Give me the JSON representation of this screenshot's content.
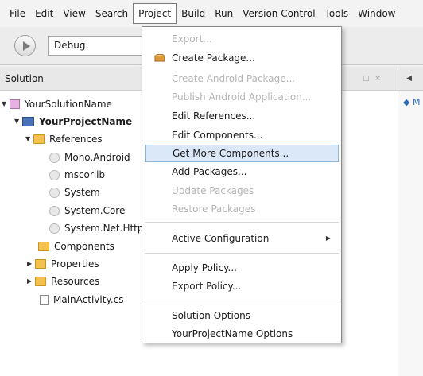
{
  "menubar": {
    "items": [
      "File",
      "Edit",
      "View",
      "Search",
      "Project",
      "Build",
      "Run",
      "Version Control",
      "Tools",
      "Window"
    ],
    "active": "Project"
  },
  "toolbar": {
    "configuration": "Debug"
  },
  "solution_pane": {
    "title": "Solution",
    "controls": "□ ×",
    "tree": [
      {
        "label": "YourSolutionName",
        "icon": "solution-icon",
        "expanded": true
      },
      {
        "label": "YourProjectName",
        "icon": "project-icon",
        "expanded": true,
        "bold": true
      },
      {
        "label": "References",
        "icon": "folder-icon",
        "expanded": true
      },
      {
        "label": "Mono.Android",
        "icon": "reference-icon"
      },
      {
        "label": "mscorlib",
        "icon": "reference-icon"
      },
      {
        "label": "System",
        "icon": "reference-icon"
      },
      {
        "label": "System.Core",
        "icon": "reference-icon"
      },
      {
        "label": "System.Net.Http",
        "icon": "reference-icon"
      },
      {
        "label": "Components",
        "icon": "folder-icon"
      },
      {
        "label": "Properties",
        "icon": "folder-icon",
        "expanded": false
      },
      {
        "label": "Resources",
        "icon": "folder-icon",
        "expanded": false
      },
      {
        "label": "MainActivity.cs",
        "icon": "file-icon"
      }
    ]
  },
  "right_panel": {
    "tab_arrow": "◀",
    "item_label": "M"
  },
  "project_menu": {
    "items": [
      {
        "label": "Export...",
        "disabled": true
      },
      {
        "label": "Create Package...",
        "icon": "package-icon"
      },
      {
        "label": "Create Android Package...",
        "disabled": true
      },
      {
        "label": "Publish Android Application...",
        "disabled": true
      },
      {
        "label": "Edit References..."
      },
      {
        "label": "Edit Components..."
      },
      {
        "label": "Get More Components...",
        "highlighted": true
      },
      {
        "label": "Add Packages..."
      },
      {
        "label": "Update Packages",
        "disabled": true
      },
      {
        "label": "Restore Packages",
        "disabled": true
      },
      {
        "label": "Active Configuration",
        "submenu": true
      },
      {
        "label": "Apply Policy..."
      },
      {
        "label": "Export Policy..."
      },
      {
        "label": "Solution Options"
      },
      {
        "label": "YourProjectName Options"
      }
    ]
  },
  "colors": {
    "highlight_bg": "#dbe8f8",
    "highlight_border": "#8cb3e0",
    "disabled_text": "#b4b4b4"
  }
}
